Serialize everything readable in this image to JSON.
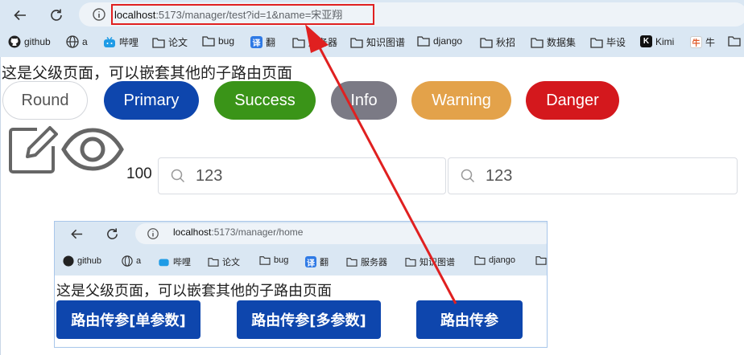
{
  "browser": {
    "url_host": "localhost",
    "url_rest": ":5173/manager/test?id=1&name=宋亚翔",
    "bookmarks": [
      "github",
      "a",
      "哔哩",
      "论文",
      "bug",
      "翻",
      "服务器",
      "知识图谱",
      "django",
      "秋招",
      "数据集",
      "毕设",
      "Kimi",
      "牛"
    ]
  },
  "page": {
    "parent_text": "这是父级页面，可以嵌套其他的子路由页面",
    "buttons": {
      "round": "Round",
      "primary": "Primary",
      "success": "Success",
      "info": "Info",
      "warning": "Warning",
      "danger": "Danger"
    },
    "count": "100",
    "search1": "123",
    "search2": "123"
  },
  "inner": {
    "url_host": "localhost",
    "url_rest": ":5173/manager/home",
    "bookmarks": [
      "github",
      "a",
      "哔哩",
      "论文",
      "bug",
      "翻",
      "服务器",
      "知识图谱",
      "django"
    ],
    "parent_text": "这是父级页面，可以嵌套其他的子路由页面",
    "buttons": [
      "路由传参[单参数]",
      "路由传参[多参数]",
      "路由传参"
    ]
  },
  "colors": {
    "primary": "#0e46ad",
    "success": "#3a9418",
    "info": "#7b7a85",
    "warning": "#e3a24a",
    "danger": "#d4181d",
    "annotation": "#e02020"
  }
}
